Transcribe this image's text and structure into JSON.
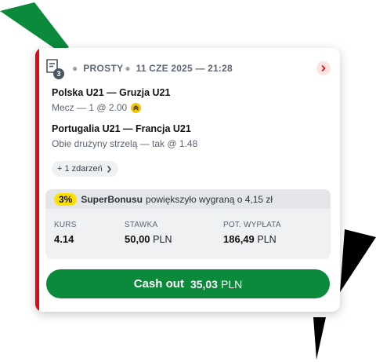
{
  "colors": {
    "accent_red": "#e30613",
    "cashout_green": "#0a8a3a",
    "bonus_yellow": "#ffe100",
    "deco_green": "#0a8a3a",
    "deco_black": "#000000"
  },
  "header": {
    "ticket_icon": "ticket-icon",
    "ticket_count": "3",
    "bet_type": "PROSTY",
    "date": "11 CZE 2025 — 21:28",
    "open_icon": "chevron-right-icon"
  },
  "events": [
    {
      "title": "Polska U21 — Gruzja U21",
      "selection": "Mecz — 1 @ 2.00",
      "boost_icon": "boost-icon"
    },
    {
      "title": "Portugalia U21 — Francja U21",
      "selection": "Obie drużyny strzelą — tak @ 1.48"
    }
  ],
  "more_events": {
    "label": "+ 1 zdarzeń",
    "icon": "chevron-right-icon"
  },
  "bonus": {
    "percent": "3%",
    "name": "SuperBonusu",
    "text": "powiększyło wygraną o 4,15 zł"
  },
  "stats": {
    "odds": {
      "label": "KURS",
      "value": "4.14"
    },
    "stake": {
      "label": "STAWKA",
      "value": "50,00",
      "currency": "PLN"
    },
    "payout": {
      "label": "POT. WYPŁATA",
      "value": "186,49",
      "currency": "PLN"
    }
  },
  "cashout": {
    "label": "Cash out",
    "amount": "35,03",
    "currency": "PLN"
  }
}
